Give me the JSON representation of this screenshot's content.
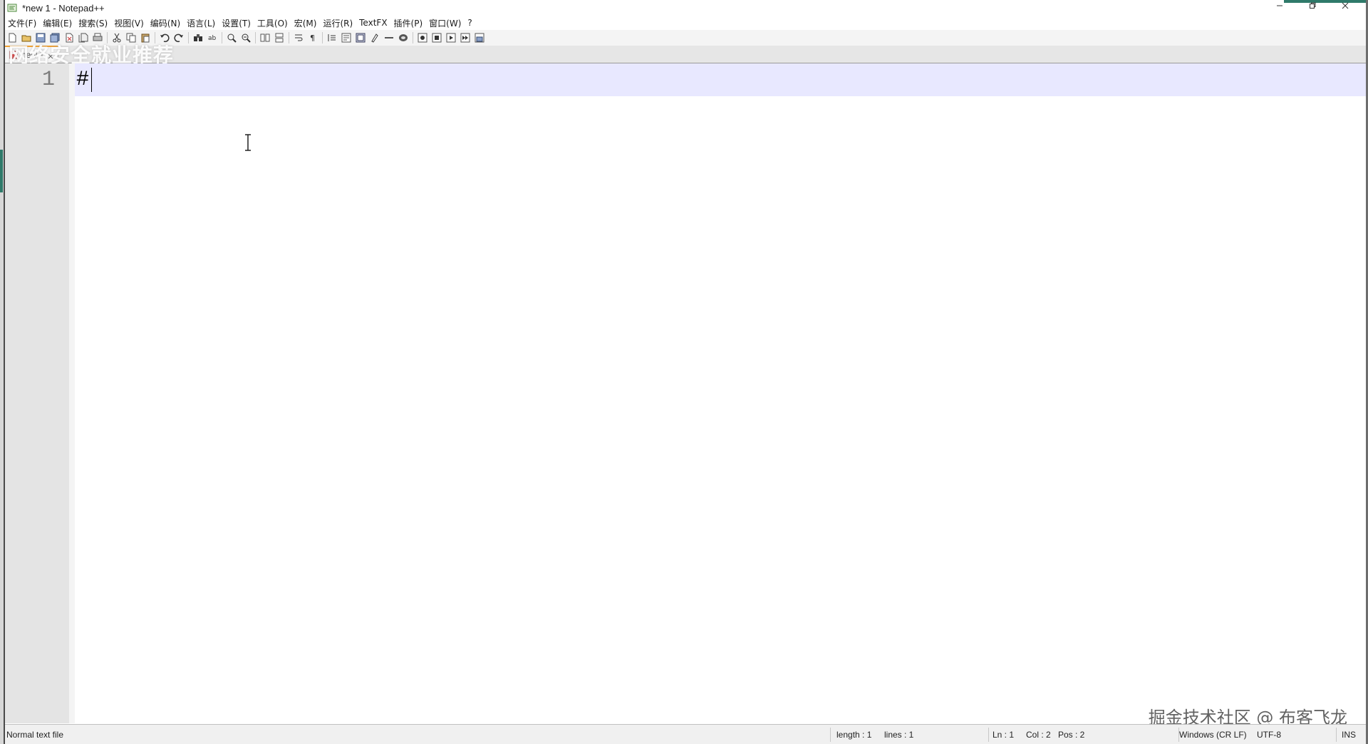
{
  "window": {
    "title": "*new 1 - Notepad++",
    "controls": {
      "minimize_icon": "minimize-icon",
      "maximize_icon": "maximize-icon",
      "close_icon": "close-icon"
    },
    "accent_color": "#2f7a6a"
  },
  "menu": {
    "items": [
      {
        "label": "文件(F)"
      },
      {
        "label": "编辑(E)"
      },
      {
        "label": "搜索(S)"
      },
      {
        "label": "视图(V)"
      },
      {
        "label": "编码(N)"
      },
      {
        "label": "语言(L)"
      },
      {
        "label": "设置(T)"
      },
      {
        "label": "工具(O)"
      },
      {
        "label": "宏(M)"
      },
      {
        "label": "运行(R)"
      },
      {
        "label": "TextFX"
      },
      {
        "label": "插件(P)"
      },
      {
        "label": "窗口(W)"
      },
      {
        "label": "?"
      }
    ]
  },
  "toolbar": {
    "buttons": [
      "new-file-icon",
      "open-file-icon",
      "save-icon",
      "save-all-icon",
      "close-file-icon",
      "close-all-icon",
      "print-icon",
      "cut-icon",
      "copy-icon",
      "paste-icon",
      "undo-icon",
      "redo-icon",
      "find-icon",
      "replace-icon",
      "zoom-in-icon",
      "zoom-out-icon",
      "sync-vertical-icon",
      "sync-horizontal-icon",
      "word-wrap-icon",
      "show-all-chars-icon",
      "indent-guide-icon",
      "user-lang-icon",
      "doc-map-icon",
      "function-list-icon",
      "folder-workspace-icon",
      "monitor-icon",
      "record-macro-icon",
      "stop-record-icon",
      "play-macro-icon",
      "run-multiple-icon",
      "save-macro-icon"
    ]
  },
  "tabs": [
    {
      "label": "new 1",
      "icon": "unsaved-file-icon"
    }
  ],
  "overlay_caption": "网络安全就业推荐",
  "editor": {
    "lines": [
      {
        "number": "1",
        "text": "#"
      }
    ],
    "current_line_color": "#e8e8ff"
  },
  "watermark": "掘金技术社区 @ 布客飞龙",
  "status": {
    "file_type": "Normal text file",
    "length": "length : 1",
    "lines": "lines : 1",
    "ln": "Ln : 1",
    "col": "Col : 2",
    "pos": "Pos : 2",
    "eol": "Windows (CR LF)",
    "encoding": "UTF-8",
    "mode": "INS"
  }
}
